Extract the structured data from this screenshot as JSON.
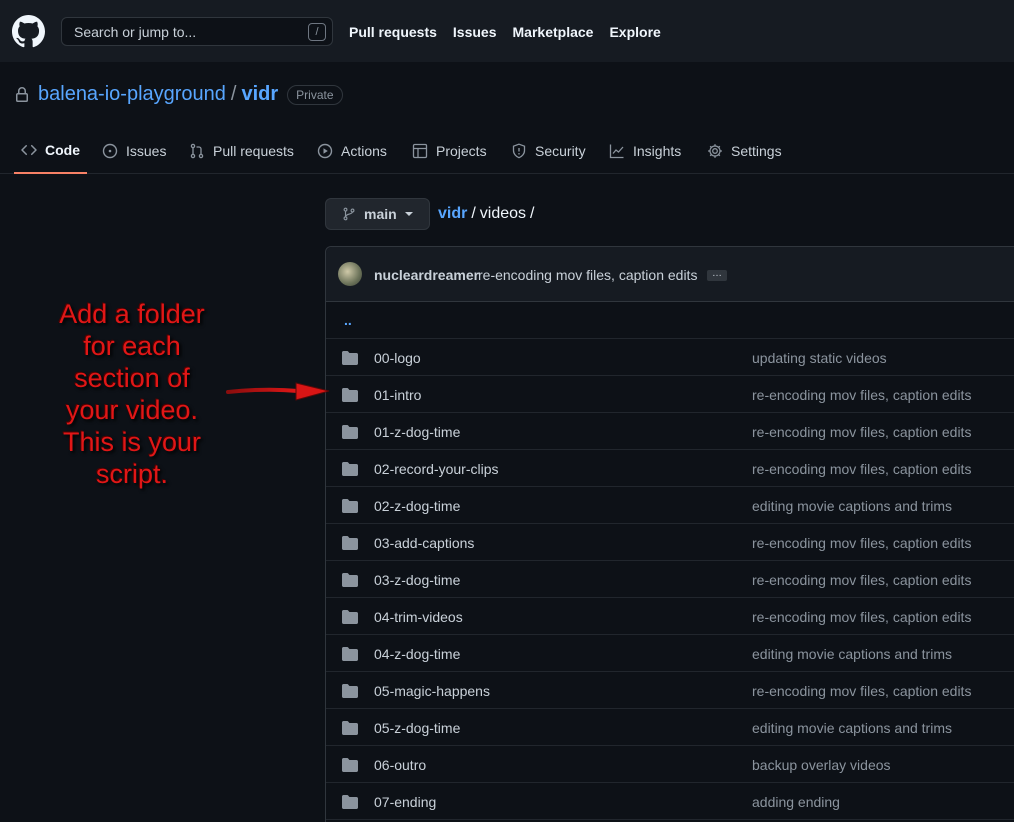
{
  "header": {
    "search_placeholder": "Search or jump to...",
    "search_shortcut": "/",
    "nav": [
      "Pull requests",
      "Issues",
      "Marketplace",
      "Explore"
    ]
  },
  "repo": {
    "owner": "balena-io-playground",
    "separator": "/",
    "name": "vidr",
    "visibility": "Private"
  },
  "tabs": [
    {
      "label": "Code",
      "icon": "code-icon",
      "active": true
    },
    {
      "label": "Issues",
      "icon": "issue-opened-icon"
    },
    {
      "label": "Pull requests",
      "icon": "git-pull-request-icon"
    },
    {
      "label": "Actions",
      "icon": "play-icon"
    },
    {
      "label": "Projects",
      "icon": "table-icon"
    },
    {
      "label": "Security",
      "icon": "shield-icon"
    },
    {
      "label": "Insights",
      "icon": "graph-icon"
    },
    {
      "label": "Settings",
      "icon": "gear-icon"
    }
  ],
  "branch": {
    "label": "main"
  },
  "breadcrumb": {
    "root": "vidr",
    "sep1": "/",
    "path": "videos",
    "sep2": "/"
  },
  "latest_commit": {
    "author": "nucleardreamer",
    "message": "re-encoding mov files, caption edits",
    "more": "…"
  },
  "parent_link": "..",
  "files": [
    {
      "name": "00-logo",
      "message": "updating static videos"
    },
    {
      "name": "01-intro",
      "message": "re-encoding mov files, caption edits"
    },
    {
      "name": "01-z-dog-time",
      "message": "re-encoding mov files, caption edits"
    },
    {
      "name": "02-record-your-clips",
      "message": "re-encoding mov files, caption edits"
    },
    {
      "name": "02-z-dog-time",
      "message": "editing movie captions and trims"
    },
    {
      "name": "03-add-captions",
      "message": "re-encoding mov files, caption edits"
    },
    {
      "name": "03-z-dog-time",
      "message": "re-encoding mov files, caption edits"
    },
    {
      "name": "04-trim-videos",
      "message": "re-encoding mov files, caption edits"
    },
    {
      "name": "04-z-dog-time",
      "message": "editing movie captions and trims"
    },
    {
      "name": "05-magic-happens",
      "message": "re-encoding mov files, caption edits"
    },
    {
      "name": "05-z-dog-time",
      "message": "editing movie captions and trims"
    },
    {
      "name": "06-outro",
      "message": "backup overlay videos"
    },
    {
      "name": "07-ending",
      "message": "adding ending"
    }
  ],
  "annotation": {
    "lines": [
      "Add a folder",
      "for each",
      "section of",
      "your video.",
      "This is your",
      "script."
    ],
    "color": "#e01717"
  },
  "colors": {
    "accent_link": "#58a6ff",
    "active_tab_underline": "#f78166",
    "background": "#0d1117"
  }
}
